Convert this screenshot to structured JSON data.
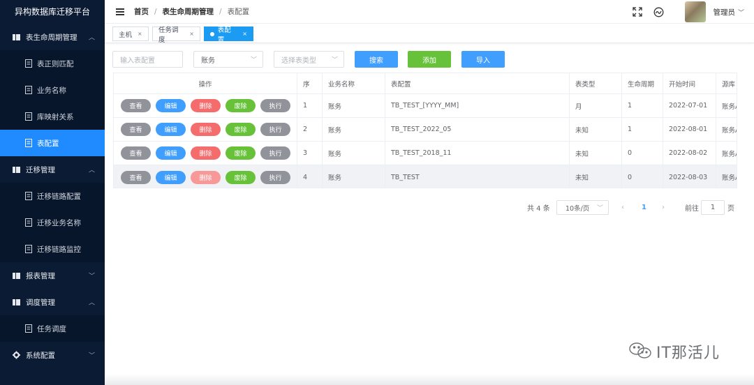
{
  "app": {
    "title": "异构数据库迁移平台"
  },
  "sidebar": {
    "groups": [
      {
        "label": "表生命周期管理",
        "icon": "book-icon",
        "expanded": true,
        "items": [
          {
            "label": "表正则匹配",
            "icon": "doc-icon"
          },
          {
            "label": "业务名称",
            "icon": "doc-icon"
          },
          {
            "label": "库映射关系",
            "icon": "doc-icon"
          },
          {
            "label": "表配置",
            "icon": "doc-icon",
            "active": true
          }
        ]
      },
      {
        "label": "迁移管理",
        "icon": "book-icon",
        "expanded": true,
        "items": [
          {
            "label": "迁移链路配置",
            "icon": "doc-icon"
          },
          {
            "label": "迁移业务名称",
            "icon": "doc-icon"
          },
          {
            "label": "迁移链路监控",
            "icon": "doc-icon"
          }
        ]
      },
      {
        "label": "报表管理",
        "icon": "book-icon",
        "expanded": false,
        "items": []
      },
      {
        "label": "调度管理",
        "icon": "book-icon",
        "expanded": true,
        "items": [
          {
            "label": "任务调度",
            "icon": "doc-icon"
          }
        ]
      },
      {
        "label": "系统配置",
        "icon": "gear-icon",
        "expanded": false,
        "items": []
      }
    ]
  },
  "header": {
    "breadcrumbs": [
      "首页",
      "表生命周期管理",
      "表配置"
    ],
    "user": "管理员"
  },
  "tabs": [
    {
      "label": "主机",
      "active": false
    },
    {
      "label": "任务调度",
      "active": false
    },
    {
      "label": "表配置",
      "active": true
    }
  ],
  "filters": {
    "table_config_placeholder": "输入表配置",
    "business_value": "账务",
    "table_type_placeholder": "选择表类型"
  },
  "buttons": {
    "search": "搜索",
    "add": "添加",
    "import": "导入"
  },
  "table": {
    "headers": [
      "操作",
      "序",
      "业务名称",
      "表配置",
      "表类型",
      "生命周期",
      "开始时间",
      "源库"
    ],
    "row_actions": [
      "查看",
      "编辑",
      "删除",
      "废除",
      "执行"
    ],
    "rows": [
      {
        "seq": "1",
        "business": "账务",
        "config": "TB_TEST_[YYYY_MM]",
        "type": "月",
        "lifecycle": "1",
        "start": "2022-07-01",
        "source": "账务A"
      },
      {
        "seq": "2",
        "business": "账务",
        "config": "TB_TEST_2022_05",
        "type": "未知",
        "lifecycle": "1",
        "start": "2022-08-01",
        "source": "账务A"
      },
      {
        "seq": "3",
        "business": "账务",
        "config": "TB_TEST_2018_11",
        "type": "未知",
        "lifecycle": "0",
        "start": "2022-08-02",
        "source": "账务A"
      },
      {
        "seq": "4",
        "business": "账务",
        "config": "TB_TEST",
        "type": "未知",
        "lifecycle": "0",
        "start": "2022-08-03",
        "source": "账务A"
      }
    ]
  },
  "pagination": {
    "total": "共 4 条",
    "page_size": "10条/页",
    "current_page": "1",
    "goto_label": "前往",
    "goto_value": "1",
    "page_suffix": "页"
  },
  "watermark": {
    "text": "IT那活儿"
  },
  "colors": {
    "primary": "#409eff",
    "success": "#67c23a",
    "danger": "#f56c6c",
    "info": "#909399",
    "sidebar_bg": "#0b1b33",
    "active_menu": "#1f8bff"
  }
}
